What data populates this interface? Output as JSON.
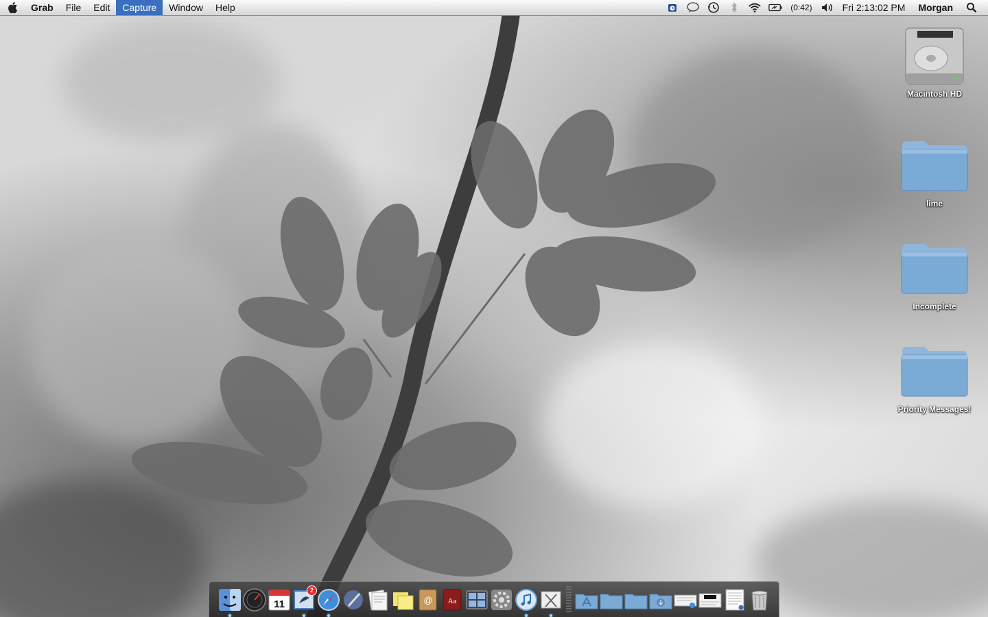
{
  "menubar": {
    "app_name": "Grab",
    "items": [
      "File",
      "Edit",
      "Capture",
      "Window",
      "Help"
    ],
    "active_item": "Capture",
    "battery_time": "(0:42)",
    "clock": "Fri 2:13:02 PM",
    "user": "Morgan"
  },
  "desktop": {
    "icons": [
      {
        "label": "Macintosh HD",
        "icon": "hard-drive-icon"
      },
      {
        "label": "lime",
        "icon": "folder-icon"
      },
      {
        "label": "Incomplete",
        "icon": "folder-icon"
      },
      {
        "label": "Priority Messages!",
        "icon": "folder-icon"
      }
    ]
  },
  "dock": {
    "apps": [
      {
        "name": "Finder",
        "icon": "finder-icon",
        "running": true
      },
      {
        "name": "Dashboard",
        "icon": "dashboard-icon",
        "running": false
      },
      {
        "name": "iCal",
        "icon": "calendar-icon",
        "running": false,
        "label": "11"
      },
      {
        "name": "Mail",
        "icon": "mail-icon",
        "running": true,
        "badge": "2"
      },
      {
        "name": "Safari",
        "icon": "safari-icon",
        "running": true
      },
      {
        "name": "Xcode",
        "icon": "xcode-icon",
        "running": false
      },
      {
        "name": "Preview",
        "icon": "preview-icon",
        "running": false
      },
      {
        "name": "Stickies",
        "icon": "stickies-icon",
        "running": false
      },
      {
        "name": "Address Book",
        "icon": "address-book-icon",
        "running": false
      },
      {
        "name": "Dictionary",
        "icon": "dictionary-icon",
        "running": false,
        "label": "Aa"
      },
      {
        "name": "Spaces",
        "icon": "spaces-icon",
        "running": false
      },
      {
        "name": "System Preferences",
        "icon": "system-preferences-icon",
        "running": false
      },
      {
        "name": "iTunes",
        "icon": "itunes-icon",
        "running": true
      },
      {
        "name": "Grab",
        "icon": "grab-icon",
        "running": true
      }
    ],
    "stacks": [
      {
        "name": "Applications",
        "icon": "applications-folder-icon"
      },
      {
        "name": "Documents",
        "icon": "documents-folder-icon"
      },
      {
        "name": "Folder",
        "icon": "folder-stack-icon"
      },
      {
        "name": "Downloads",
        "icon": "downloads-folder-icon"
      },
      {
        "name": "Document 1",
        "icon": "document-icon"
      },
      {
        "name": "Document 2",
        "icon": "document-icon"
      },
      {
        "name": "Document 3",
        "icon": "document-icon"
      },
      {
        "name": "Trash",
        "icon": "trash-icon"
      }
    ]
  },
  "colors": {
    "menu_highlight": "#3a6fbf",
    "folder_blue": "#7aaad6",
    "badge_red": "#e22222"
  }
}
